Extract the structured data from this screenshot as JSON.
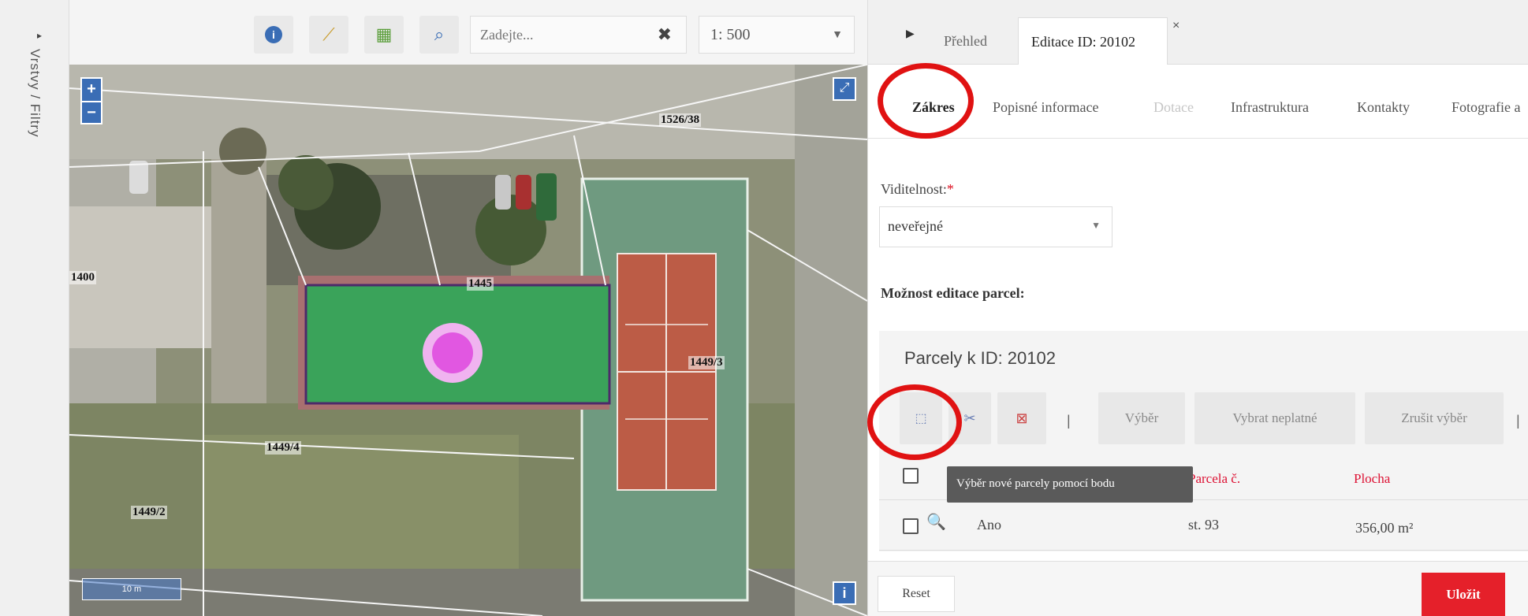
{
  "layers_panel": {
    "label": "Vrstvy / Filtry"
  },
  "map_toolbar": {
    "search_placeholder": "Zadejte...",
    "scale_value": "1: 500"
  },
  "map": {
    "scalebar_label": "10 m",
    "parcel_labels": [
      "1526/38",
      "1445",
      "1449/3",
      "1449/4",
      "1449/2",
      "1400"
    ]
  },
  "panel": {
    "tabs": {
      "overview": "Přehled",
      "edit": "Editace ID: 20102",
      "close": "×"
    },
    "subtabs": [
      "Zákres",
      "Popisné informace",
      "Dotace",
      "Infrastruktura",
      "Kontakty",
      "Fotografie a"
    ],
    "visibility": {
      "label": "Viditelnost:",
      "required": "*",
      "value": "neveřejné"
    },
    "parcel_edit_label": "Možnost editace parcel:",
    "parcels": {
      "title": "Parcely k ID: 20102",
      "buttons": {
        "select": "Výběr",
        "select_invalid": "Vybrat neplatné",
        "cancel_select": "Zrušit výběr"
      },
      "tooltip": "Výběr nové parcely pomocí bodu",
      "columns": {
        "parcel_no": "Parcela č.",
        "area": "Plocha"
      },
      "rows": [
        {
          "value": "Ano",
          "parcel_no": "st. 93",
          "area": "356,00 m²"
        }
      ]
    },
    "footer": {
      "reset": "Reset",
      "save": "Uložit"
    }
  }
}
